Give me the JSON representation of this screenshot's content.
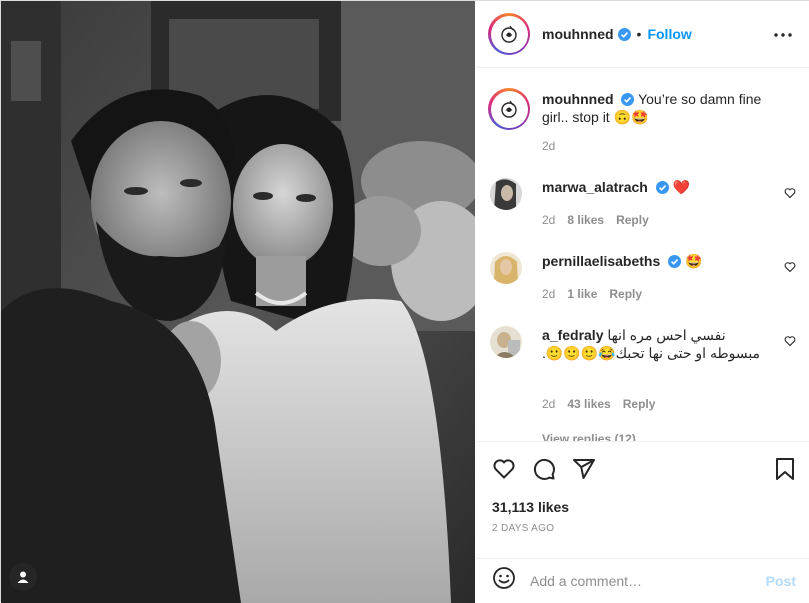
{
  "post": {
    "username": "mouhnned",
    "follow_label": "Follow",
    "separator": "•",
    "caption": {
      "username": "mouhnned",
      "text": "You’re so damn fine girl.. stop it 🙃🤩",
      "age": "2d"
    },
    "comments": [
      {
        "username": "marwa_alatrach",
        "text": "❤️",
        "age": "2d",
        "likes": "8 likes",
        "reply": "Reply",
        "verified": true
      },
      {
        "username": "pernillaelisabeths",
        "text": "🤩",
        "age": "2d",
        "likes": "1 like",
        "reply": "Reply",
        "verified": true
      },
      {
        "username": "a_fedraly",
        "text": "نفسي احس مره انها مبسوطه او حتى نها تحبك😂🙂🙂🙂.",
        "age": "2d",
        "likes": "43 likes",
        "reply": "Reply",
        "verified": false
      }
    ],
    "view_replies": "View replies (12)",
    "likes_count": "31,113 likes",
    "date": "2 DAYS AGO",
    "add_comment_placeholder": "Add a comment…",
    "post_label": "Post"
  },
  "icons": {
    "header_more": "more-horizontal-icon",
    "like": "heart-outline-icon",
    "comment": "comment-bubble-icon",
    "share": "paper-plane-icon",
    "save": "bookmark-icon",
    "emoji": "smiley-face-icon",
    "tag": "user-tag-icon",
    "verified": "verified-badge-icon"
  },
  "colors": {
    "accent": "#0095f6",
    "post_disabled": "#b3dbff",
    "muted": "#8e8e8e",
    "heart_red": "#ed4956",
    "text": "#262626"
  }
}
